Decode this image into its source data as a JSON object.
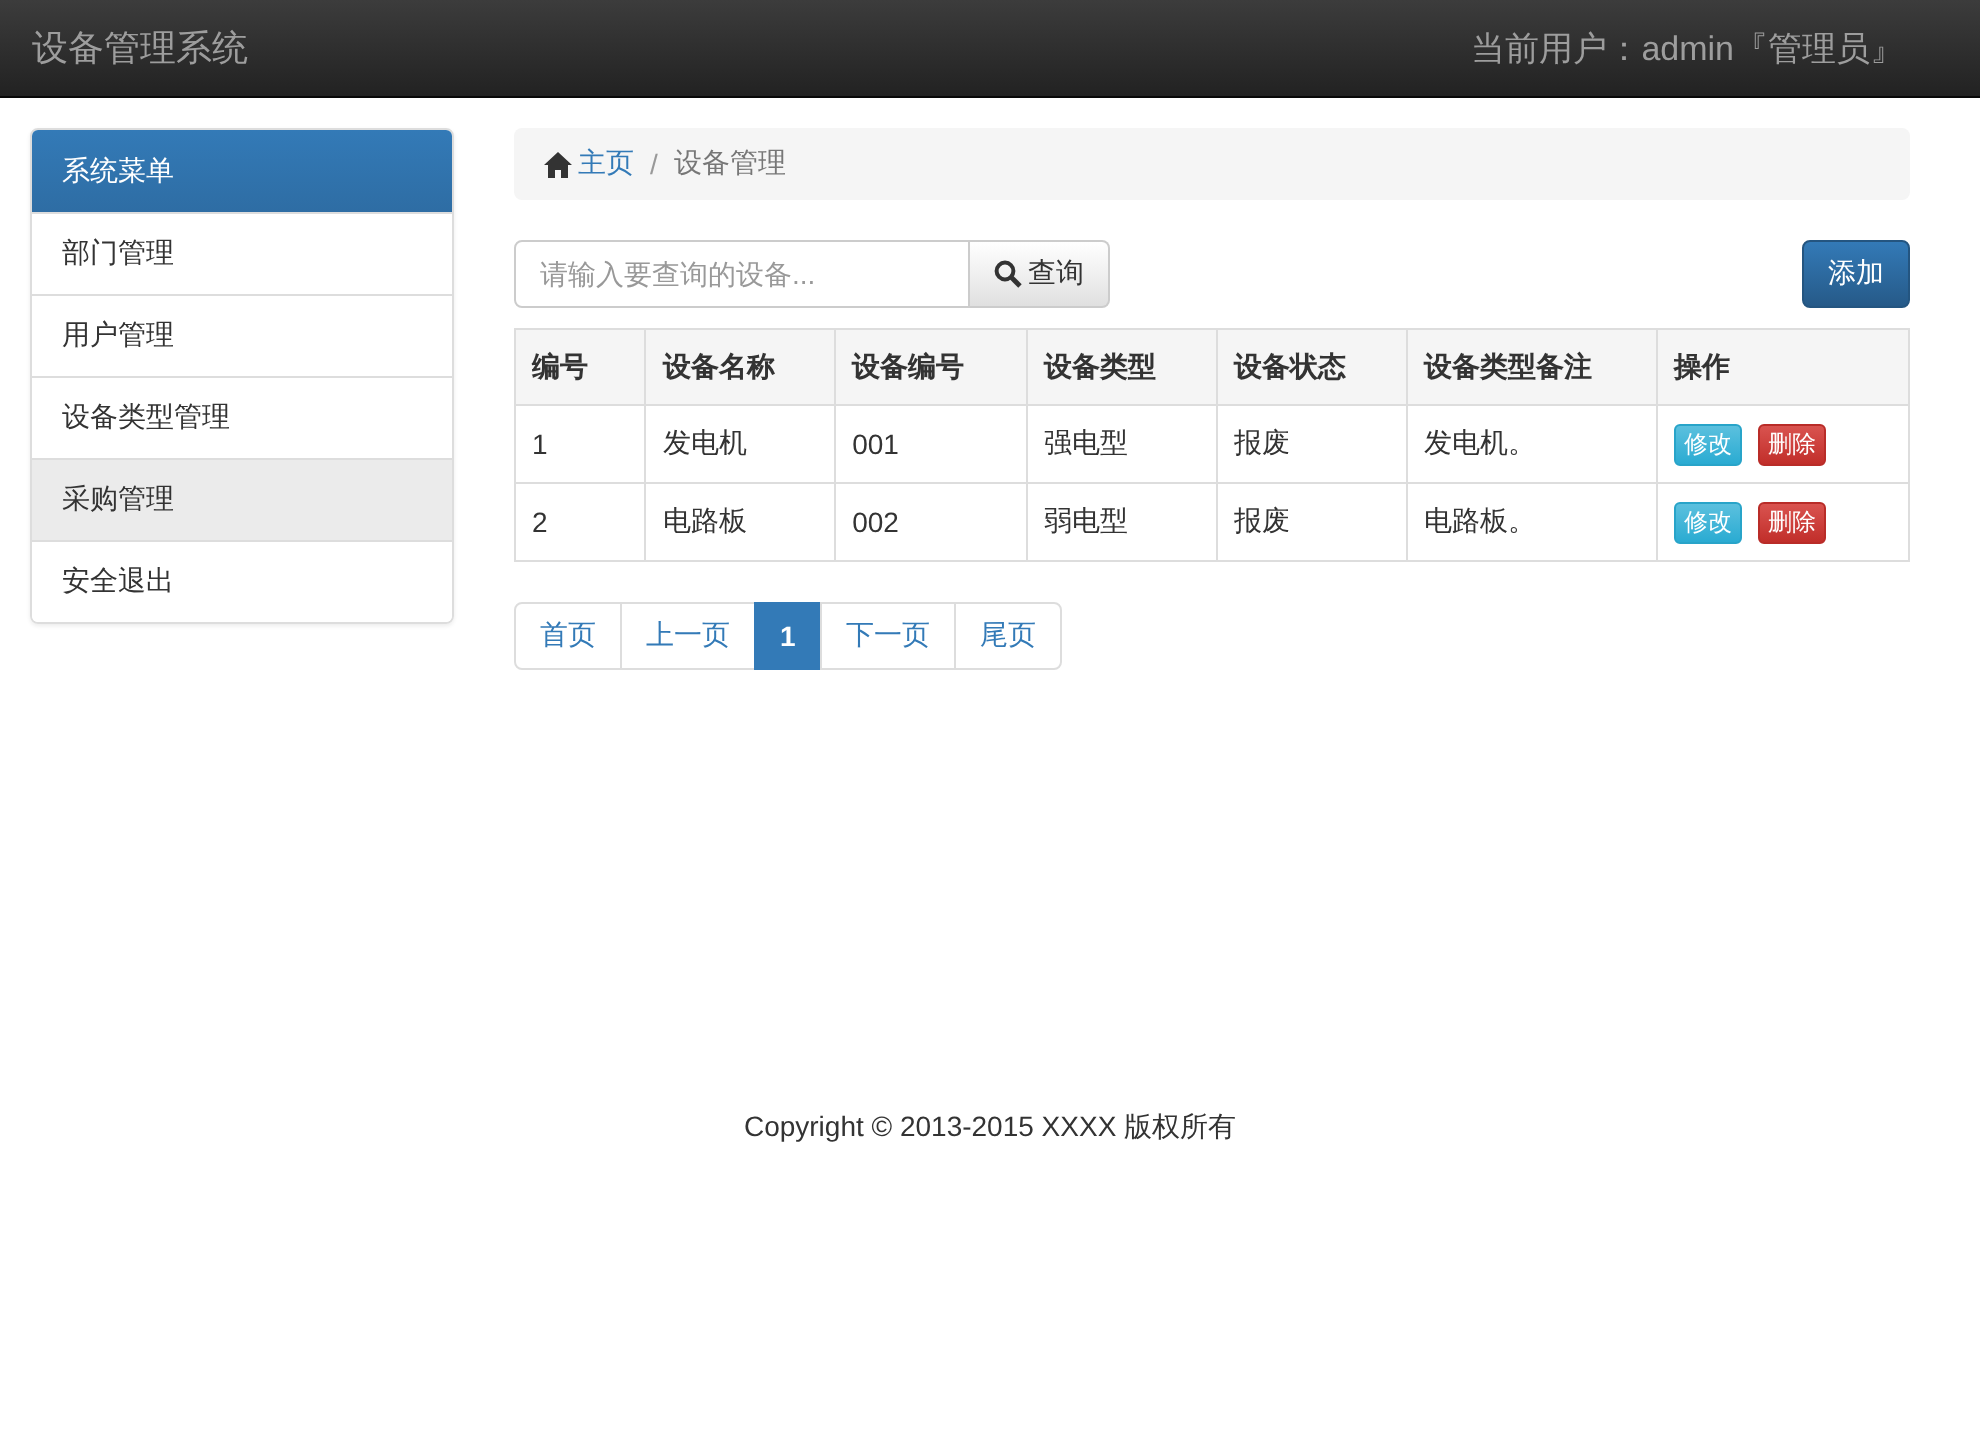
{
  "navbar": {
    "brand": "设备管理系统",
    "user": "当前用户：admin『管理员』"
  },
  "sidebar": {
    "heading": "系统菜单",
    "items": [
      {
        "label": "部门管理",
        "selected": false
      },
      {
        "label": "用户管理",
        "selected": false
      },
      {
        "label": "设备类型管理",
        "selected": false
      },
      {
        "label": "采购管理",
        "selected": true
      },
      {
        "label": "安全退出",
        "selected": false
      }
    ]
  },
  "breadcrumb": {
    "home": "主页",
    "separator": "/",
    "current": "设备管理"
  },
  "search": {
    "placeholder": "请输入要查询的设备...",
    "button": "查询"
  },
  "add_button": "添加",
  "table": {
    "columns": [
      "编号",
      "设备名称",
      "设备编号",
      "设备类型",
      "设备状态",
      "设备类型备注",
      "操作"
    ],
    "rows": [
      {
        "cells": [
          "1",
          "发电机",
          "001",
          "强电型",
          "报废",
          "发电机。"
        ],
        "actions": [
          "修改",
          "删除"
        ]
      },
      {
        "cells": [
          "2",
          "电路板",
          "002",
          "弱电型",
          "报废",
          "电路板。"
        ],
        "actions": [
          "修改",
          "删除"
        ]
      }
    ]
  },
  "pagination": [
    {
      "label": "首页",
      "selected": false
    },
    {
      "label": "上一页",
      "selected": false
    },
    {
      "label": "1",
      "selected": true
    },
    {
      "label": "下一页",
      "selected": false
    },
    {
      "label": "尾页",
      "selected": false
    }
  ],
  "footer": "Copyright © 2013-2015 XXXX 版权所有"
}
